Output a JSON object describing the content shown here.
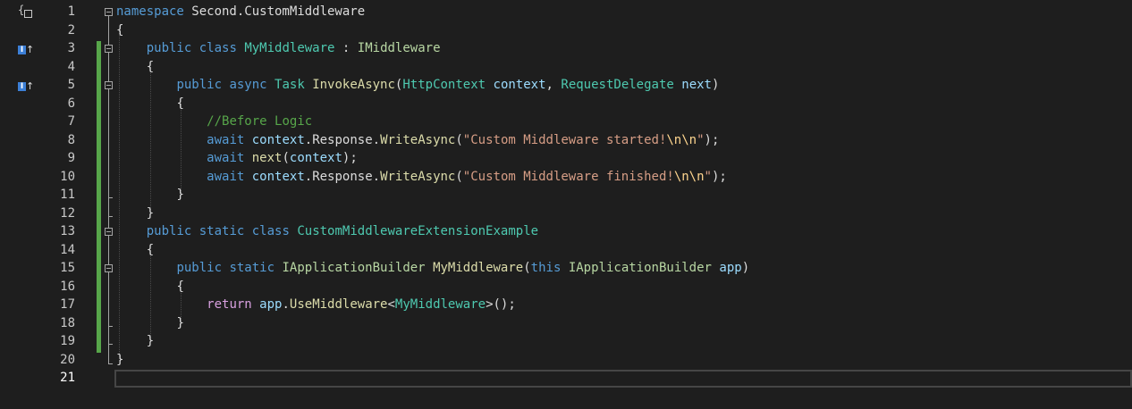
{
  "editor": {
    "current_line": 21,
    "lines": [
      {
        "n": "1"
      },
      {
        "n": "2"
      },
      {
        "n": "3"
      },
      {
        "n": "4"
      },
      {
        "n": "5"
      },
      {
        "n": "6"
      },
      {
        "n": "7"
      },
      {
        "n": "8"
      },
      {
        "n": "9"
      },
      {
        "n": "10"
      },
      {
        "n": "11"
      },
      {
        "n": "12"
      },
      {
        "n": "13"
      },
      {
        "n": "14"
      },
      {
        "n": "15"
      },
      {
        "n": "16"
      },
      {
        "n": "17"
      },
      {
        "n": "18"
      },
      {
        "n": "19"
      },
      {
        "n": "20"
      },
      {
        "n": "21"
      }
    ],
    "tokens": {
      "l1_namespace": "namespace",
      "l1_name": " Second.CustomMiddleware",
      "l2": "{",
      "l3_public": "public",
      "l3_class": "class",
      "l3_name": "MyMiddleware",
      "l3_sep": " : ",
      "l3_iface": "IMiddleware",
      "l4": "{",
      "l5_public": "public",
      "l5_async": "async",
      "l5_task": "Task",
      "l5_method": "InvokeAsync",
      "l5_open": "(",
      "l5_type1": "HttpContext",
      "l5_p1": "context",
      "l5_comma": ", ",
      "l5_type2": "RequestDelegate",
      "l5_p2": "next",
      "l5_close": ")",
      "l6": "{",
      "l7_comment": "//Before Logic",
      "l8_await": "await",
      "l8_ctx": "context",
      "l8_mid": ".Response.",
      "l8_method": "WriteAsync",
      "l8_open": "(",
      "l8_str": "\"Custom Middleware started!",
      "l8_esc": "\\n\\n",
      "l8_strend": "\"",
      "l8_close": ");",
      "l9_await": "await",
      "l9_next": "next",
      "l9_open": "(",
      "l9_ctx": "context",
      "l9_close": ");",
      "l10_await": "await",
      "l10_ctx": "context",
      "l10_mid": ".Response.",
      "l10_method": "WriteAsync",
      "l10_open": "(",
      "l10_str": "\"Custom Middleware finished!",
      "l10_esc": "\\n\\n",
      "l10_strend": "\"",
      "l10_close": ");",
      "l11": "}",
      "l12": "}",
      "l13_public": "public",
      "l13_static": "static",
      "l13_class": "class",
      "l13_name": "CustomMiddlewareExtensionExample",
      "l14": "{",
      "l15_public": "public",
      "l15_static": "static",
      "l15_ret": "IApplicationBuilder",
      "l15_method": "MyMiddleware",
      "l15_open": "(",
      "l15_this": "this",
      "l15_type": "IApplicationBuilder",
      "l15_p": "app",
      "l15_close": ")",
      "l16": "{",
      "l17_return": "return",
      "l17_app": "app",
      "l17_dot": ".",
      "l17_method": "UseMiddleware",
      "l17_lt": "<",
      "l17_type": "MyMiddleware",
      "l17_gt": ">();",
      "l18": "}",
      "l19": "}",
      "l20": "}"
    },
    "gutter": {
      "impl_glyph_label": "I",
      "impl_arrow": "↑",
      "scope_glyph": "{ }"
    },
    "colors": {
      "background": "#1e1e1e",
      "keyword": "#569cd6",
      "control_keyword": "#d8a0df",
      "type": "#4ec9b0",
      "method": "#dcdcaa",
      "parameter": "#9cdcfe",
      "string": "#d69d85",
      "escape": "#ffd68f",
      "comment": "#57a64a",
      "change_bar": "#57a64a"
    }
  }
}
